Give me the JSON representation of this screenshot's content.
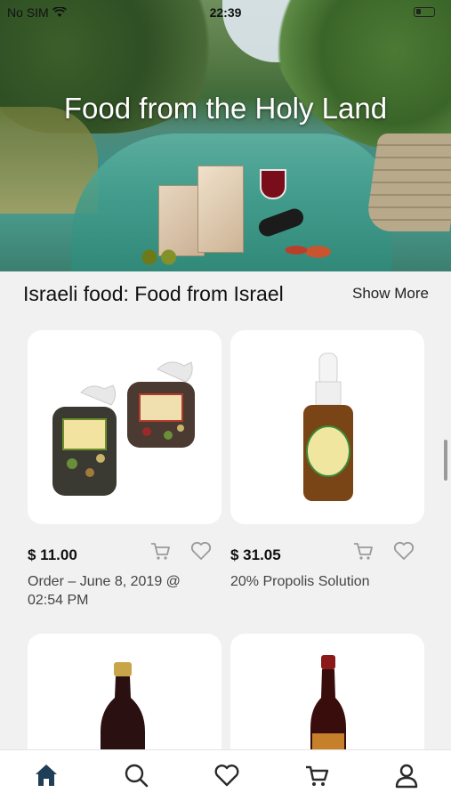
{
  "status_bar": {
    "carrier": "No SIM",
    "time": "22:39"
  },
  "hero": {
    "title": "Food from the Holy Land"
  },
  "section": {
    "title": "Israeli food: Food from Israel",
    "show_more": "Show More"
  },
  "products": [
    {
      "price": "$ 11.00",
      "name": "Order – June 8, 2019 @ 02:54 PM",
      "image": "two bags of mixed spices"
    },
    {
      "price": "$ 31.05",
      "name": "20% Propolis Solution",
      "image": "amber dropper bottle"
    },
    {
      "price": "",
      "name": "",
      "image": "dark wine bottle"
    },
    {
      "price": "",
      "name": "",
      "image": "wine bottle with label"
    }
  ],
  "tabs": [
    {
      "id": "home",
      "icon": "home-icon",
      "active": true
    },
    {
      "id": "search",
      "icon": "search-icon",
      "active": false
    },
    {
      "id": "favorites",
      "icon": "heart-icon",
      "active": false
    },
    {
      "id": "cart",
      "icon": "cart-icon",
      "active": false
    },
    {
      "id": "account",
      "icon": "user-icon",
      "active": false
    }
  ],
  "colors": {
    "accent": "#1f3e57",
    "tab_inactive": "#2a2a2a",
    "card_bg": "#ffffff",
    "page_bg": "#f1f1f1"
  }
}
